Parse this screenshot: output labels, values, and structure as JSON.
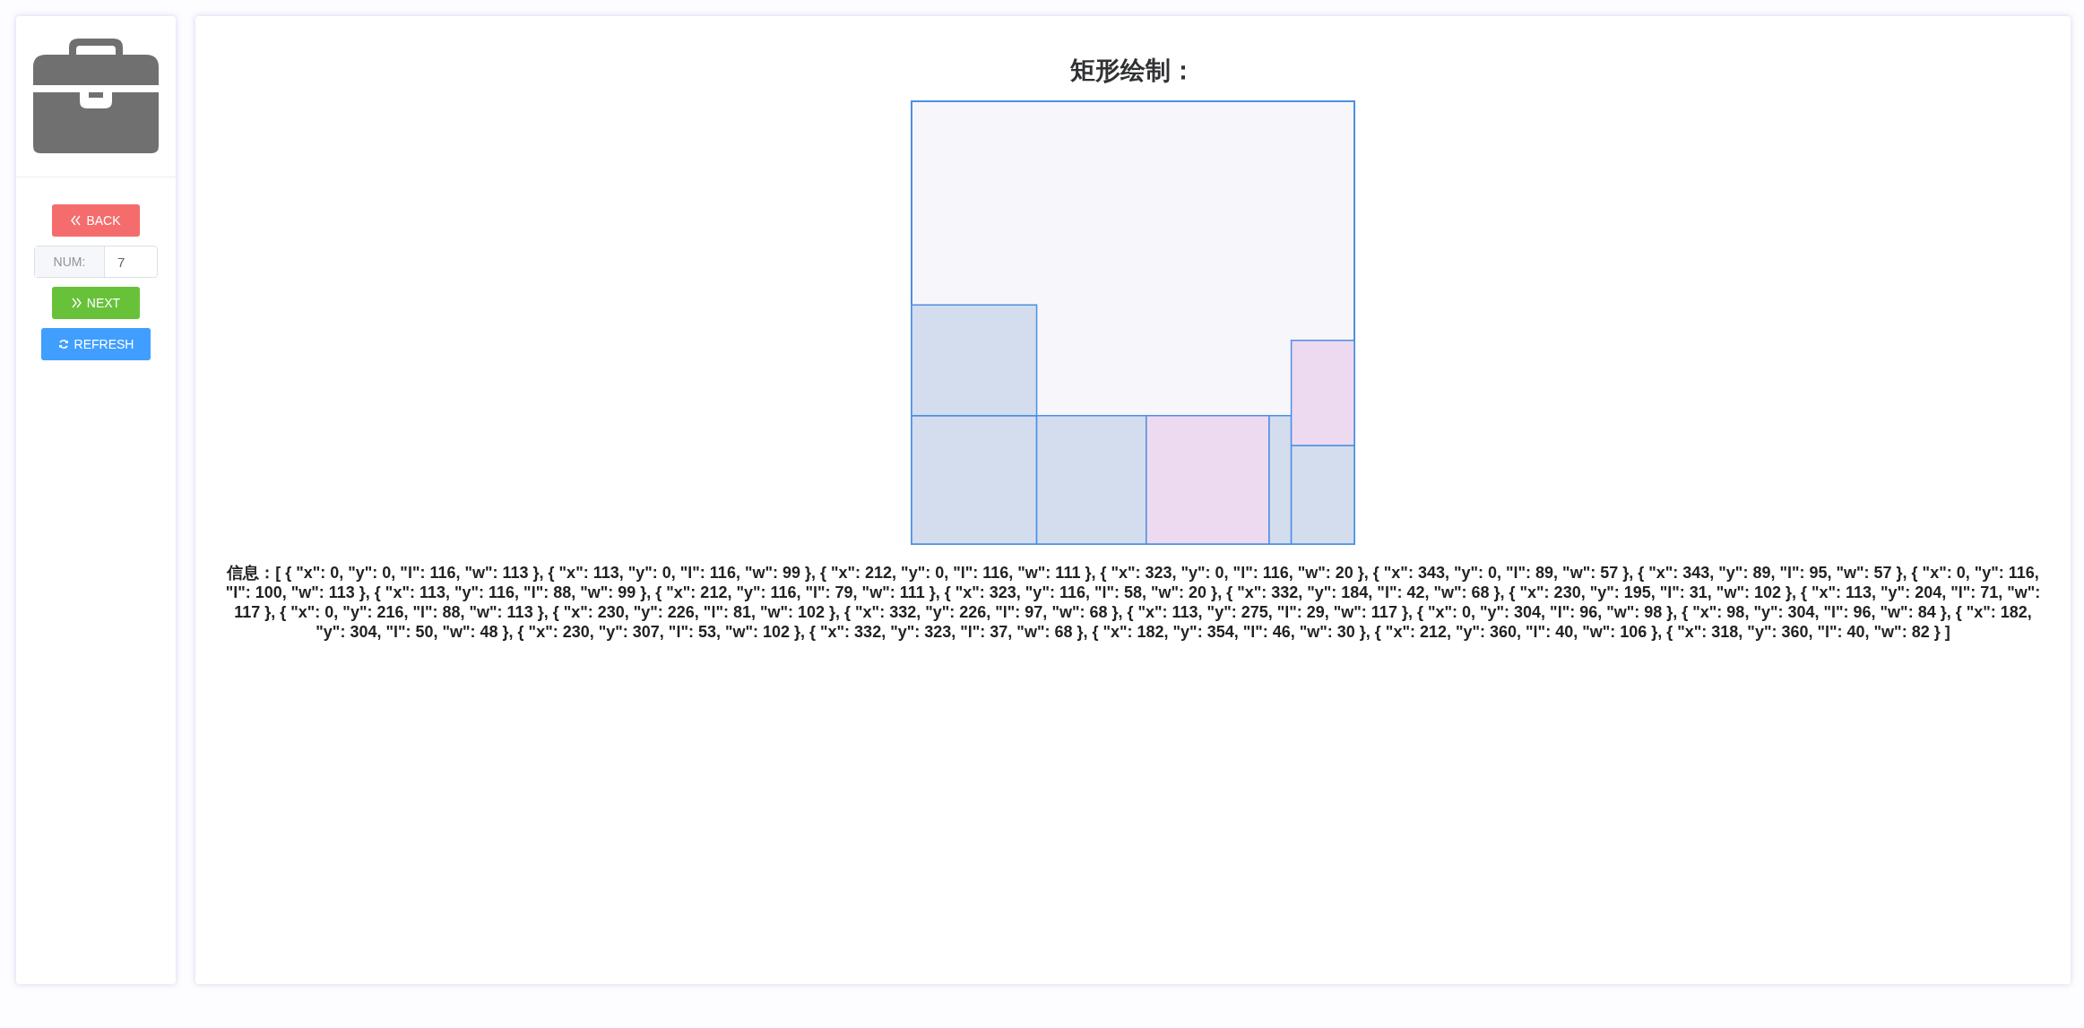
{
  "sidebar": {
    "buttons": [
      {
        "kind": "back",
        "label": "BACK"
      },
      {
        "kind": "num",
        "label": "NUM:",
        "value": "7"
      },
      {
        "kind": "next",
        "label": "NEXT"
      },
      {
        "kind": "refresh",
        "label": "REFRESH"
      }
    ]
  },
  "main": {
    "title": "矩形绘制：",
    "drawing": {
      "rects": [
        {
          "color": "#d3ddee"
        },
        {
          "color": "#d3ddee"
        },
        {
          "color": "#eedaf0"
        },
        {
          "color": "#d3ddee"
        },
        {
          "color": "#d3ddee"
        },
        {
          "color": "#eedaf0"
        },
        {
          "color": "#d3ddee"
        }
      ]
    },
    "info": "信息：[ { \"x\": 0, \"y\": 0, \"l\": 116, \"w\": 113 }, { \"x\": 113, \"y\": 0, \"l\": 116, \"w\": 99 }, { \"x\": 212, \"y\": 0, \"l\": 116, \"w\": 111 }, { \"x\": 323, \"y\": 0, \"l\": 116, \"w\": 20 }, { \"x\": 343, \"y\": 0, \"l\": 89, \"w\": 57 }, { \"x\": 343, \"y\": 89, \"l\": 95, \"w\": 57 }, { \"x\": 0, \"y\": 116, \"l\": 100, \"w\": 113 }, { \"x\": 113, \"y\": 116, \"l\": 88, \"w\": 99 }, { \"x\": 212, \"y\": 116, \"l\": 79, \"w\": 111 }, { \"x\": 323, \"y\": 116, \"l\": 58, \"w\": 20 }, { \"x\": 332, \"y\": 184, \"l\": 42, \"w\": 68 }, { \"x\": 230, \"y\": 195, \"l\": 31, \"w\": 102 }, { \"x\": 113, \"y\": 204, \"l\": 71, \"w\": 117 }, { \"x\": 0, \"y\": 216, \"l\": 88, \"w\": 113 }, { \"x\": 230, \"y\": 226, \"l\": 81, \"w\": 102 }, { \"x\": 332, \"y\": 226, \"l\": 97, \"w\": 68 }, { \"x\": 113, \"y\": 275, \"l\": 29, \"w\": 117 }, { \"x\": 0, \"y\": 304, \"l\": 96, \"w\": 98 }, { \"x\": 98, \"y\": 304, \"l\": 96, \"w\": 84 }, { \"x\": 182, \"y\": 304, \"l\": 50, \"w\": 48 }, { \"x\": 230, \"y\": 307, \"l\": 53, \"w\": 102 }, { \"x\": 332, \"y\": 323, \"l\": 37, \"w\": 68 }, { \"x\": 182, \"y\": 354, \"l\": 46, \"w\": 30 }, { \"x\": 212, \"y\": 360, \"l\": 40, \"w\": 106 }, { \"x\": 318, \"y\": 360, \"l\": 40, \"w\": 82 } ]"
  }
}
